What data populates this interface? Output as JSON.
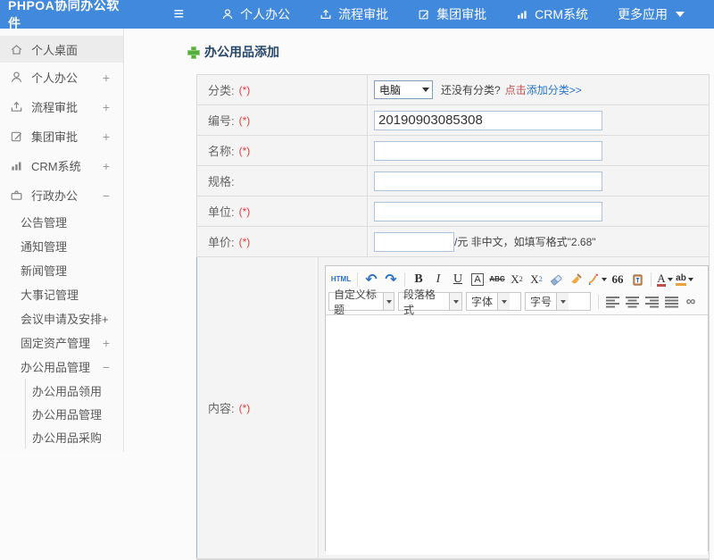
{
  "topbar": {
    "logo": "PHPOA协同办公软件",
    "nav": [
      {
        "label": "个人办公",
        "icon": "user-icon"
      },
      {
        "label": "流程审批",
        "icon": "flow-icon"
      },
      {
        "label": "集团审批",
        "icon": "edit-icon"
      },
      {
        "label": "CRM系统",
        "icon": "chart-icon"
      },
      {
        "label": "更多应用",
        "icon": "caret-down-icon"
      }
    ]
  },
  "sidebar": {
    "items": [
      {
        "label": "个人桌面",
        "icon": "home-icon",
        "expander": ""
      },
      {
        "label": "个人办公",
        "icon": "user-icon",
        "expander": "+"
      },
      {
        "label": "流程审批",
        "icon": "flow-icon",
        "expander": "+"
      },
      {
        "label": "集团审批",
        "icon": "edit-icon",
        "expander": "+"
      },
      {
        "label": "CRM系统",
        "icon": "chart-icon",
        "expander": "+"
      },
      {
        "label": "行政办公",
        "icon": "briefcase-icon",
        "expander": "−"
      }
    ],
    "admin_children": [
      {
        "label": "公告管理",
        "expander": ""
      },
      {
        "label": "通知管理",
        "expander": ""
      },
      {
        "label": "新闻管理",
        "expander": ""
      },
      {
        "label": "大事记管理",
        "expander": ""
      },
      {
        "label": "会议申请及安排+",
        "expander": ""
      },
      {
        "label": "固定资产管理",
        "expander": "+"
      },
      {
        "label": "办公用品管理",
        "expander": "−"
      }
    ],
    "supplies_children": [
      {
        "label": "办公用品领用"
      },
      {
        "label": "办公用品管理"
      },
      {
        "label": "办公用品采购"
      }
    ]
  },
  "main": {
    "page_title": "办公用品添加",
    "form": {
      "rows": [
        {
          "label": "分类:",
          "req": "(*)"
        },
        {
          "label": "编号:",
          "req": "(*)",
          "value": "20190903085308"
        },
        {
          "label": "名称:",
          "req": "(*)"
        },
        {
          "label": "规格:",
          "req": ""
        },
        {
          "label": "单位:",
          "req": "(*)"
        },
        {
          "label": "单价:",
          "req": "(*)",
          "suffix": "/元 非中文，如填写格式\"2.68\""
        },
        {
          "label": "内容:",
          "req": "(*)"
        }
      ],
      "category": {
        "selected": "电脑",
        "hint": "还没有分类?",
        "link_click": "点击",
        "link_add": "添加分类>>"
      }
    }
  },
  "editor": {
    "toolbar": {
      "html": "HTML",
      "bold": "B",
      "italic": "I",
      "underline": "U",
      "fontborder": "A",
      "strikethrough": "ABC",
      "sup_base": "X",
      "sup_mark": "2",
      "sub_base": "X",
      "sub_mark": "2",
      "quote": "66",
      "forecolor": "A",
      "backcolor": "ab",
      "combos": [
        {
          "label": "自定义标题"
        },
        {
          "label": "段落格式"
        },
        {
          "label": "字体"
        },
        {
          "label": "字号"
        }
      ]
    }
  },
  "glyphs": {
    "hamburger": "≡",
    "undo": "↶",
    "redo": "↷",
    "link": "∞"
  },
  "colors": {
    "topbar_blue": "#4189dc",
    "link_blue": "#2a75c9",
    "required_red": "#e23b3b",
    "title_navy": "#28486e",
    "plus_green": "#57ad3f"
  }
}
